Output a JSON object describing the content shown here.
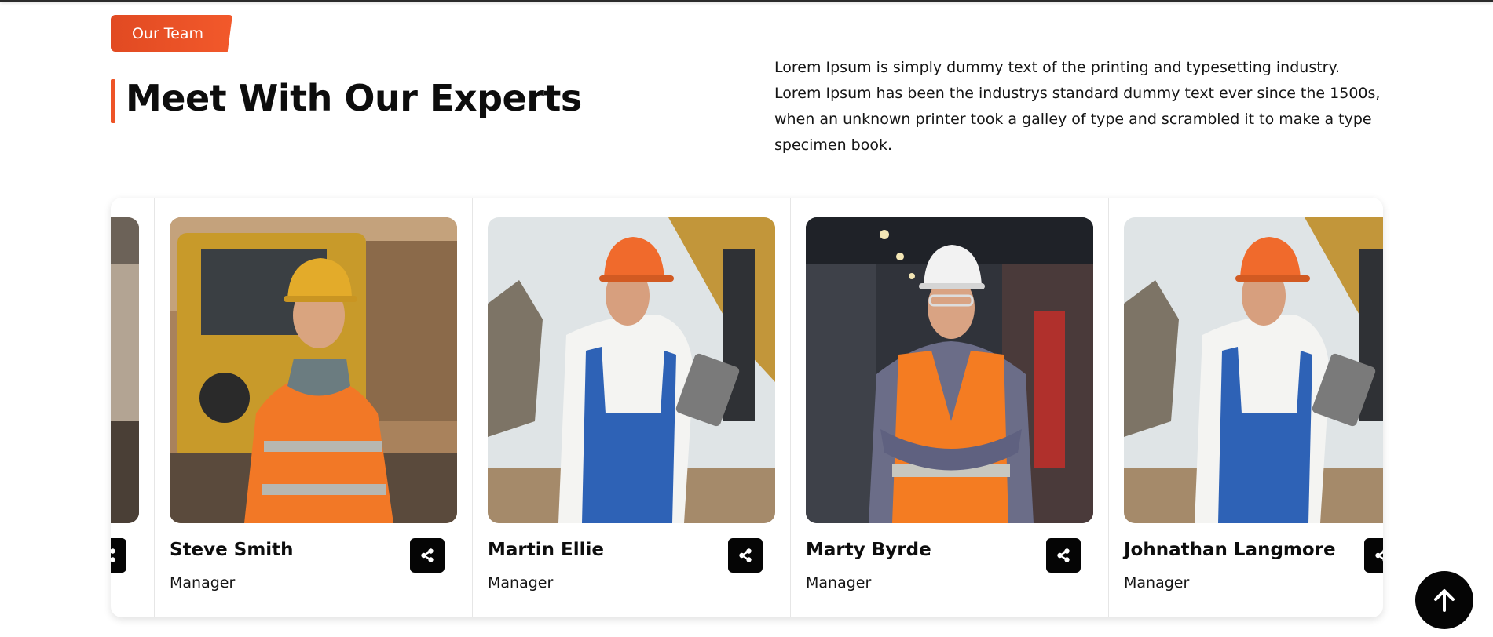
{
  "section": {
    "badge_label": "Our Team",
    "title": "Meet With Our Experts",
    "intro": "Lorem Ipsum is simply dummy text of the printing and typesetting industry. Lorem Ipsum has been the industrys standard dummy text ever since the 1500s, when an unknown printer took a galley of type and scrambled it to make a type specimen book."
  },
  "team": [
    {
      "name": "Steve Smith",
      "role": "Manager",
      "icon": "share-icon"
    },
    {
      "name": "Martin Ellie",
      "role": "Manager",
      "icon": "share-icon"
    },
    {
      "name": "Marty Byrde",
      "role": "Manager",
      "icon": "share-icon"
    },
    {
      "name": "Johnathan Langmore",
      "role": "Manager",
      "icon": "share-icon"
    }
  ],
  "scroll_top": {
    "icon": "arrow-up-icon"
  },
  "colors": {
    "accent": "#ee5427",
    "dark": "#050505",
    "text": "#0d0d0d"
  }
}
